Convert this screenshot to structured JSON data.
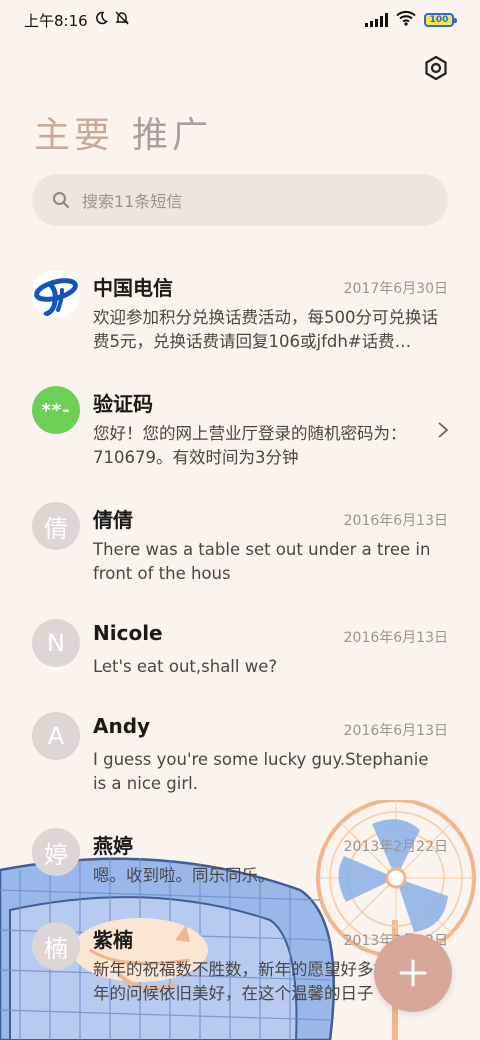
{
  "status_bar": {
    "time": "上午8:16",
    "battery": "100"
  },
  "tabs": [
    {
      "label": "主要"
    },
    {
      "label": "推广"
    }
  ],
  "search": {
    "placeholder": "搜索11条短信"
  },
  "messages": [
    {
      "name": "中国电信",
      "date": "2017年6月30日",
      "preview": "欢迎参加积分兑换话费活动，每500分可兑换话费5元，兑换话费请回复106或jfdh#话费…",
      "avatar": "telecom-logo"
    },
    {
      "name": "验证码",
      "date": "",
      "preview": "您好！您的网上营业厅登录的随机密码为：710679。有效时间为3分钟",
      "avatar_text": "**-"
    },
    {
      "name": "倩倩",
      "date": "2016年6月13日",
      "preview": "There was a table set out under a tree in front of the hous",
      "avatar_text": "倩"
    },
    {
      "name": "Nicole",
      "date": "2016年6月13日",
      "preview": "Let's eat out,shall we?",
      "avatar_text": "N"
    },
    {
      "name": "Andy",
      "date": "2016年6月13日",
      "preview": "I guess you're some lucky guy.Stephanie is a nice girl.",
      "avatar_text": "A"
    },
    {
      "name": "燕婷",
      "date": "2013年2月22日",
      "preview": "嗯。收到啦。同乐同乐。",
      "avatar_text": "婷"
    },
    {
      "name": "紫楠",
      "date": "2013年2月22日",
      "preview": "新年的祝福数不胜数，新年的愿望好多好多，新年的问候依旧美好，在这个温馨的日子",
      "avatar_text": "楠"
    }
  ],
  "colors": {
    "background": "#fbf3ee",
    "active_tab": "#c9a99a",
    "fab": "#d9a79a",
    "verify_avatar": "#6dd056"
  }
}
